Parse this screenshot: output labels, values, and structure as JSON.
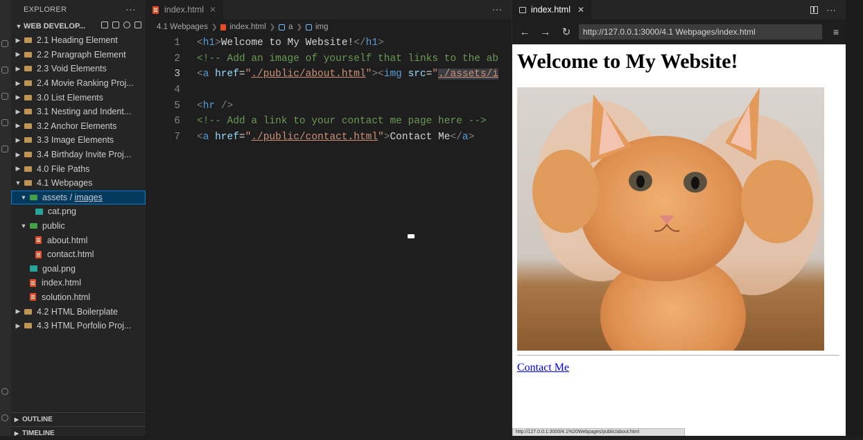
{
  "sidebar": {
    "title": "EXPLORER",
    "more": "···",
    "workspace": "WEB DEVELOP...",
    "tree": [
      {
        "label": "2.1 Heading Element",
        "kind": "folder",
        "depth": 1,
        "open": false
      },
      {
        "label": "2.2 Paragraph Element",
        "kind": "folder",
        "depth": 1,
        "open": false
      },
      {
        "label": "2.3 Void Elements",
        "kind": "folder",
        "depth": 1,
        "open": false
      },
      {
        "label": "2.4 Movie Ranking Proj...",
        "kind": "folder",
        "depth": 1,
        "open": false
      },
      {
        "label": "3.0 List Elements",
        "kind": "folder",
        "depth": 1,
        "open": false
      },
      {
        "label": "3.1 Nesting and Indent...",
        "kind": "folder",
        "depth": 1,
        "open": false
      },
      {
        "label": "3.2 Anchor Elements",
        "kind": "folder",
        "depth": 1,
        "open": false
      },
      {
        "label": "3.3 Image Elements",
        "kind": "folder",
        "depth": 1,
        "open": false
      },
      {
        "label": "3.4 Birthday Invite Proj...",
        "kind": "folder",
        "depth": 1,
        "open": false
      },
      {
        "label": "4.0 File Paths",
        "kind": "folder",
        "depth": 1,
        "open": false
      },
      {
        "label": "4.1 Webpages",
        "kind": "folder",
        "depth": 1,
        "open": true
      },
      {
        "label": "assets / images",
        "kind": "folder-green",
        "depth": 2,
        "open": true,
        "selected": true
      },
      {
        "label": "cat.png",
        "kind": "image",
        "depth": 3
      },
      {
        "label": "public",
        "kind": "folder-green",
        "depth": 2,
        "open": true
      },
      {
        "label": "about.html",
        "kind": "html",
        "depth": 3
      },
      {
        "label": "contact.html",
        "kind": "html",
        "depth": 3
      },
      {
        "label": "goal.png",
        "kind": "image",
        "depth": 2
      },
      {
        "label": "index.html",
        "kind": "html",
        "depth": 2
      },
      {
        "label": "solution.html",
        "kind": "html",
        "depth": 2
      },
      {
        "label": "4.2 HTML Boilerplate",
        "kind": "folder",
        "depth": 1,
        "open": false
      },
      {
        "label": "4.3 HTML Porfolio Proj...",
        "kind": "folder",
        "depth": 1,
        "open": false
      }
    ],
    "outline": "OUTLINE",
    "timeline": "TIMELINE"
  },
  "editor": {
    "tab_label": "index.html",
    "more": "···",
    "breadcrumbs": [
      "4.1 Webpages",
      "index.html",
      "a",
      "img"
    ],
    "lines": [
      {
        "n": "1",
        "tokens": [
          [
            "bracket",
            "<"
          ],
          [
            "tag",
            "h1"
          ],
          [
            "bracket",
            ">"
          ],
          [
            "text",
            "Welcome to My Website!"
          ],
          [
            "bracket",
            "</"
          ],
          [
            "tag",
            "h1"
          ],
          [
            "bracket",
            ">"
          ]
        ]
      },
      {
        "n": "2",
        "tokens": [
          [
            "comment",
            "<!-- Add an image of yourself that links to the ab"
          ]
        ]
      },
      {
        "n": "3",
        "active": true,
        "tokens": [
          [
            "bracket",
            "<"
          ],
          [
            "tag",
            "a"
          ],
          [
            "text",
            " "
          ],
          [
            "attr",
            "href"
          ],
          [
            "eq",
            "="
          ],
          [
            "plain",
            "\""
          ],
          [
            "str",
            "./public/about.html"
          ],
          [
            "plain",
            "\""
          ],
          [
            "bracket",
            "><"
          ],
          [
            "tag",
            "img"
          ],
          [
            "text",
            " "
          ],
          [
            "attr",
            "src"
          ],
          [
            "eq",
            "="
          ],
          [
            "plain",
            "\""
          ],
          [
            "strhl",
            "./assets/i"
          ]
        ]
      },
      {
        "n": "4",
        "tokens": []
      },
      {
        "n": "5",
        "tokens": [
          [
            "bracket",
            "<"
          ],
          [
            "tag",
            "hr"
          ],
          [
            "text",
            " "
          ],
          [
            "bracket",
            "/>"
          ]
        ]
      },
      {
        "n": "6",
        "tokens": [
          [
            "comment",
            "<!-- Add a link to your contact me page here -->"
          ]
        ]
      },
      {
        "n": "7",
        "tokens": [
          [
            "bracket",
            "<"
          ],
          [
            "tag",
            "a"
          ],
          [
            "text",
            " "
          ],
          [
            "attr",
            "href"
          ],
          [
            "eq",
            "="
          ],
          [
            "plain",
            "\""
          ],
          [
            "str",
            "./public/contact.html"
          ],
          [
            "plain",
            "\""
          ],
          [
            "bracket",
            ">"
          ],
          [
            "text",
            "Contact Me"
          ],
          [
            "bracket",
            "</"
          ],
          [
            "tag",
            "a"
          ],
          [
            "bracket",
            ">"
          ]
        ]
      }
    ]
  },
  "preview": {
    "tab_label": "index.html",
    "url": "http://127.0.0.1:3000/4.1 Webpages/index.html",
    "heading": "Welcome to My Website!",
    "link_text": "Contact Me",
    "status_url": "http://127.0.0.1:3000/4.1%20Webpages/public/about.html"
  },
  "colors": {
    "tag": "#569cd6",
    "attr": "#9cdcfe",
    "string": "#ce9178",
    "comment": "#6a9955",
    "selection": "#04395e",
    "link": "#0000ee"
  }
}
